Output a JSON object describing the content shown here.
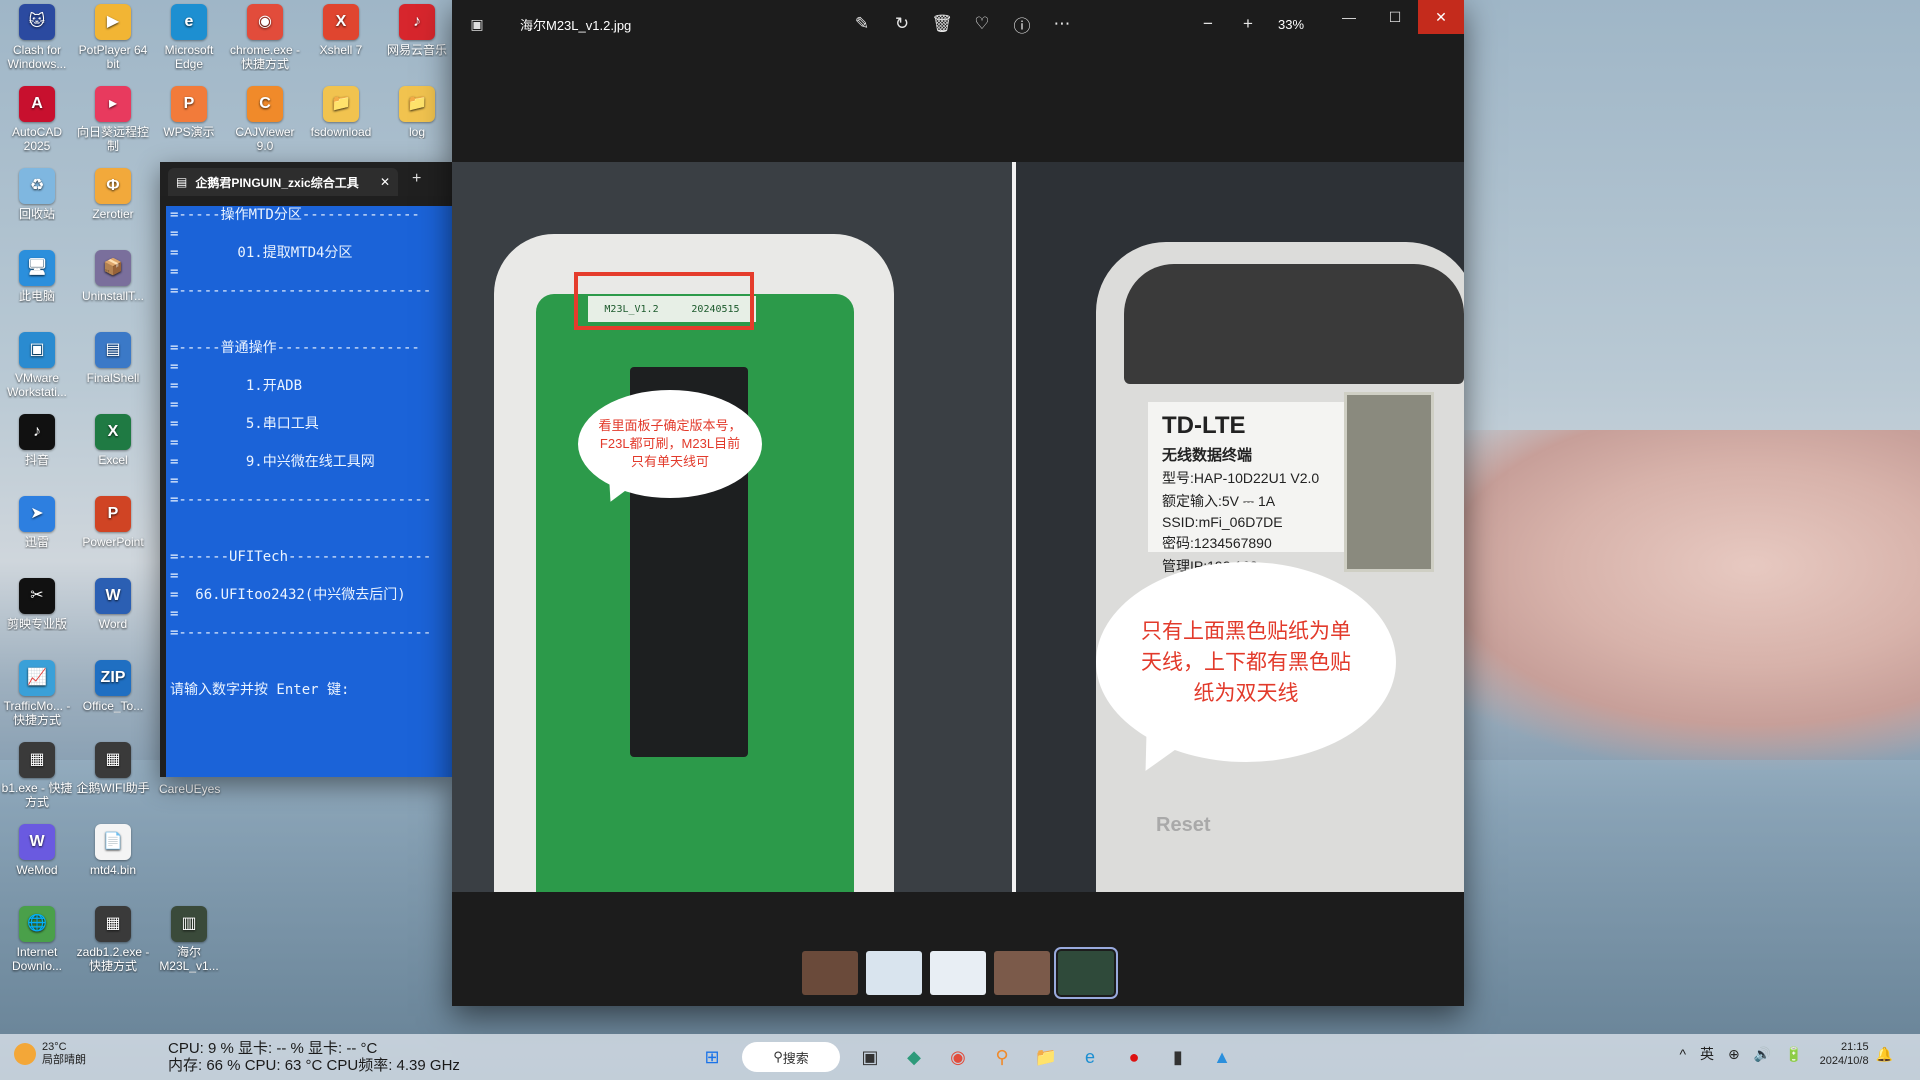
{
  "desktop": {
    "icons": [
      {
        "label": "Clash for Windows...",
        "color": "#2b4aa0",
        "glyph": "🐱"
      },
      {
        "label": "PotPlayer 64 bit",
        "color": "#f2b534",
        "glyph": "▶"
      },
      {
        "label": "Microsoft Edge",
        "color": "#1d8fd1",
        "glyph": "e"
      },
      {
        "label": "chrome.exe - 快捷方式",
        "color": "#e24c3b",
        "glyph": "◉"
      },
      {
        "label": "Xshell 7",
        "color": "#e0452f",
        "glyph": "X"
      },
      {
        "label": "网易云音乐",
        "color": "#d7262d",
        "glyph": "♪"
      },
      {
        "label": "AutoCAD 2025",
        "color": "#c8102e",
        "glyph": "A"
      },
      {
        "label": "向日葵远程控制",
        "color": "#e83a5e",
        "glyph": "▸"
      },
      {
        "label": "WPS演示",
        "color": "#f27b3a",
        "glyph": "P"
      },
      {
        "label": "CAJViewer 9.0",
        "color": "#f08a2a",
        "glyph": "C"
      },
      {
        "label": "fsdownload",
        "color": "#f1c34f",
        "glyph": "📁"
      },
      {
        "label": "log",
        "color": "#f1c34f",
        "glyph": "📁"
      },
      {
        "label": "回收站",
        "color": "#7fb7e0",
        "glyph": "♻"
      },
      {
        "label": "Zerotier",
        "color": "#f2a93b",
        "glyph": "Φ"
      },
      {
        "label": "此电脑",
        "color": "#2b8fdc",
        "glyph": "🖥"
      },
      {
        "label": "UninstallT...",
        "color": "#7a6f9c",
        "glyph": "📦"
      },
      {
        "label": "VMware Workstati...",
        "color": "#2a8bd0",
        "glyph": "▣"
      },
      {
        "label": "FinalShell",
        "color": "#3b79c7",
        "glyph": "▤"
      },
      {
        "label": "抖音",
        "color": "#111111",
        "glyph": "♪"
      },
      {
        "label": "Excel",
        "color": "#1f7a43",
        "glyph": "X"
      },
      {
        "label": "迅雷",
        "color": "#2d7fe0",
        "glyph": "➤"
      },
      {
        "label": "PowerPoint",
        "color": "#d04424",
        "glyph": "P"
      },
      {
        "label": "剪映专业版",
        "color": "#111111",
        "glyph": "✂"
      },
      {
        "label": "Word",
        "color": "#2b5fb3",
        "glyph": "W"
      },
      {
        "label": "TrafficMo... - 快捷方式",
        "color": "#3aa0d8",
        "glyph": "📈"
      },
      {
        "label": "Office_To...",
        "color": "#1f6fc2",
        "glyph": "ZIP"
      },
      {
        "label": "b1.exe - 快捷方式",
        "color": "#3a3a3a",
        "glyph": "▦"
      },
      {
        "label": "企鹅WIFI助手",
        "color": "#3a3a3a",
        "glyph": "▦"
      },
      {
        "label": "WeMod",
        "color": "#6a5ae0",
        "glyph": "W"
      },
      {
        "label": "mtd4.bin",
        "color": "#f4f4f4",
        "glyph": "📄"
      },
      {
        "label": "Internet Downlo...",
        "color": "#4aa04a",
        "glyph": "🌐"
      },
      {
        "label": "zadb1.2.exe - 快捷方式",
        "color": "#3a3a3a",
        "glyph": "▦"
      },
      {
        "label": "海尔 M23L_v1...",
        "color": "#3a4a3a",
        "glyph": "▥"
      }
    ],
    "careueyes_label": "CareUEyes"
  },
  "terminal": {
    "tab_title": "企鹅君PINGUIN_zxic综合工具",
    "tab_close": "✕",
    "new_tab": "+",
    "lines": [
      "=-----操作MTD分区--------------",
      "=",
      "=       01.提取MTD4分区",
      "=",
      "=------------------------------",
      "",
      "",
      "=-----普通操作-----------------",
      "=",
      "=        1.开ADB",
      "=",
      "=        5.串口工具",
      "=",
      "=        9.中兴微在线工具网",
      "=",
      "=------------------------------",
      "",
      "",
      "=------UFITech-----------------",
      "=",
      "=  66.UFItoo2432(中兴微去后门)",
      "=",
      "=------------------------------",
      "",
      "",
      "请输入数字并按 Enter 键:"
    ]
  },
  "viewer": {
    "file_title": "海尔M23L_v1.2.jpg",
    "zoom": "33%",
    "tools": [
      "edit-icon",
      "rotate-icon",
      "delete-icon",
      "favorite-icon",
      "info-icon",
      "more-icon"
    ],
    "tool_glyphs": [
      "✎",
      "↻",
      "🗑",
      "♡",
      "ⓘ",
      "⋯"
    ],
    "zoom_out_glyph": "−",
    "zoom_in_glyph": "+",
    "window": {
      "min": "—",
      "max": "☐",
      "close": "✕"
    },
    "photo": {
      "board_label_1": "M23L_V1.2",
      "board_label_2": "20240515",
      "bubble_small": "看里面板子确定版本号，F23L都可刷，M23L目前只有单天线可",
      "bubble_big": "只有上面黑色贴纸为单天线，上下都有黑色贴纸为双天线",
      "sticker_title": "TD-LTE",
      "sticker_sub": "无线数据终端",
      "sticker_lines": [
        "型号:HAP-10D22U1 V2.0",
        "额定输入:5V ⎓ 1A",
        "SSID:mFi_06D7DE",
        "密码:1234567890",
        "管理IP:192.168..."
      ],
      "reset": "Reset"
    },
    "thumbnails": [
      {
        "color": "#6a4a3a",
        "selected": false
      },
      {
        "color": "#d9e4ee",
        "selected": false
      },
      {
        "color": "#e8eef4",
        "selected": false
      },
      {
        "color": "#7b5a4a",
        "selected": false
      },
      {
        "color": "#2f4a3a",
        "selected": true
      }
    ]
  },
  "taskbar": {
    "weather_temp": "23°C",
    "weather_desc": "局部晴朗",
    "sysmon_line1": "CPU: 9 %   显卡: -- %   显卡: -- °C",
    "sysmon_line2": "内存: 66 % CPU: 63 °C  CPU频率: 4.39 GHz",
    "search_label": "搜索",
    "apps": [
      {
        "name": "start-icon",
        "glyph": "⊞",
        "color": "#1a73e8"
      },
      {
        "name": "taskview-icon",
        "glyph": "▣",
        "color": "#333"
      },
      {
        "name": "app-green-icon",
        "glyph": "◆",
        "color": "#2d9a7a"
      },
      {
        "name": "chrome-icon",
        "glyph": "◉",
        "color": "#e24c3b"
      },
      {
        "name": "search-tool-icon",
        "glyph": "⚲",
        "color": "#f08a2a"
      },
      {
        "name": "explorer-icon",
        "glyph": "📁",
        "color": "#f1c34f"
      },
      {
        "name": "edge-icon",
        "glyph": "e",
        "color": "#1d8fd1"
      },
      {
        "name": "record-icon",
        "glyph": "●",
        "color": "#d11"
      },
      {
        "name": "terminal-icon",
        "glyph": "▮",
        "color": "#333"
      },
      {
        "name": "photos-icon",
        "glyph": "▲",
        "color": "#2b8fdc"
      }
    ],
    "tray": [
      "^",
      "英",
      "⊕",
      "🔊",
      "🔋"
    ],
    "time": "21:15",
    "date": "2024/10/8",
    "notify": "🔔"
  }
}
